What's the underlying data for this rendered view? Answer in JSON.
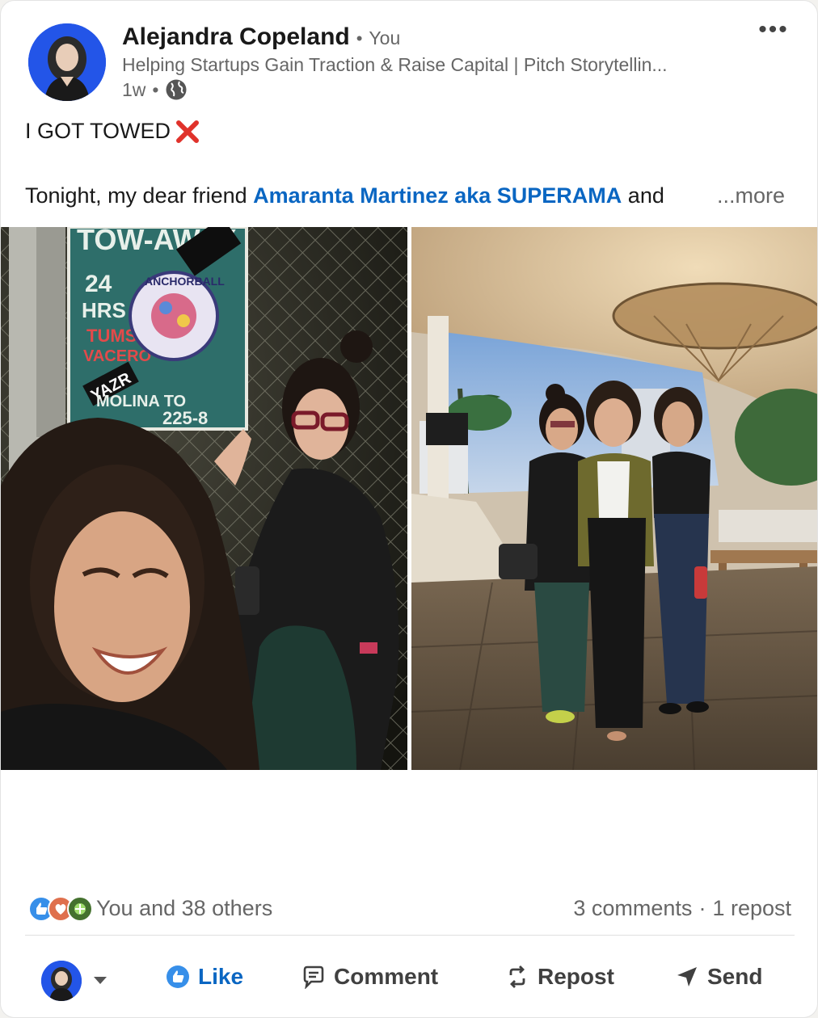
{
  "author": {
    "name": "Alejandra Copeland",
    "relation": "You",
    "headline": "Helping Startups Gain Traction & Raise Capital | Pitch Storytellin...",
    "time": "1w"
  },
  "post": {
    "title": "I GOT TOWED",
    "body_prefix": "Tonight, my dear friend ",
    "mention": "Amaranta Martinez aka SUPERAMA",
    "body_suffix": " and",
    "see_more": "...more",
    "sign_text": {
      "line1": "TOW-AWAY",
      "line2": "24",
      "line3": "HRS",
      "line4": "TUMS",
      "line5": "VACERO",
      "line6": "YAZR",
      "line7": "MOLINA TO",
      "line8": "225-8",
      "sticker": "ANCHORBALL"
    }
  },
  "social": {
    "reactions_text": "You and 38 others",
    "comments": "3 comments",
    "separator": "·",
    "reposts": "1 repost"
  },
  "actions": {
    "like": "Like",
    "comment": "Comment",
    "repost": "Repost",
    "send": "Send"
  },
  "colors": {
    "brand_blue": "#0a66c2",
    "avatar_bg": "#2355e8",
    "muted_text": "#666666"
  }
}
